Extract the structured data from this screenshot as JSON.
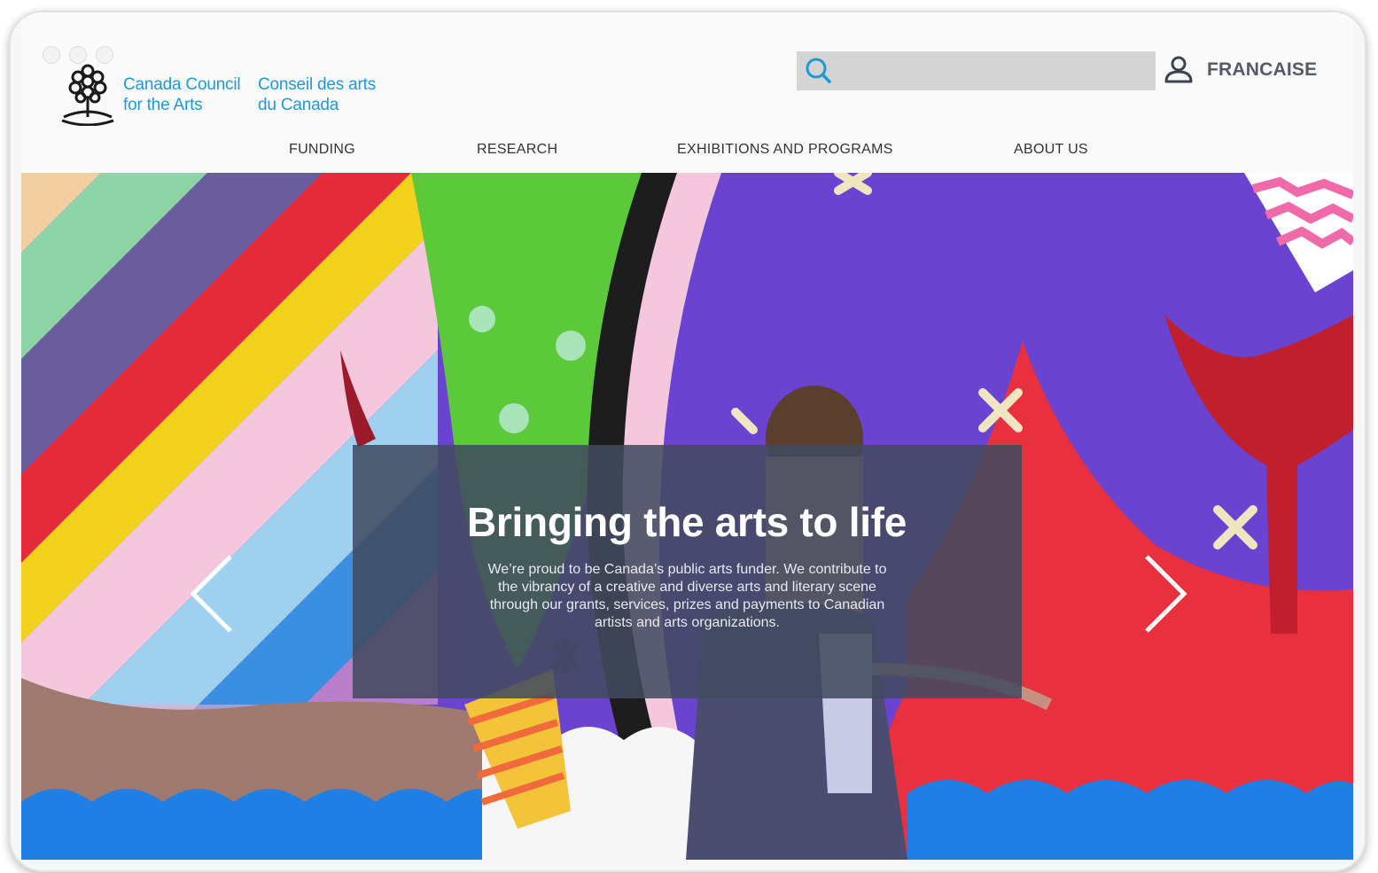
{
  "brand": {
    "name_en_line1": "Canada Council",
    "name_en_line2": "for the Arts",
    "name_fr_line1": "Conseil des arts",
    "name_fr_line2": "du Canada",
    "color": "#1c9ad6"
  },
  "header": {
    "search": {
      "placeholder": "",
      "value": ""
    },
    "language_link": "FRANCAISE"
  },
  "nav": {
    "items": [
      {
        "label": "FUNDING"
      },
      {
        "label": "RESEARCH"
      },
      {
        "label": "EXHIBITIONS AND PROGRAMS"
      },
      {
        "label": "ABOUT US"
      }
    ]
  },
  "hero": {
    "title": "Bringing the arts to life",
    "description": "We’re proud to be Canada’s public arts funder. We contribute to the vibrancy of a creative and diverse arts and literary scene through our grants, services, prizes and payments to Canadian artists and arts organizations.",
    "prev_icon": "chevron-left-icon",
    "next_icon": "chevron-right-icon"
  },
  "icons": {
    "search": "search-icon",
    "user": "user-icon",
    "logo": "tree-logo-icon"
  }
}
